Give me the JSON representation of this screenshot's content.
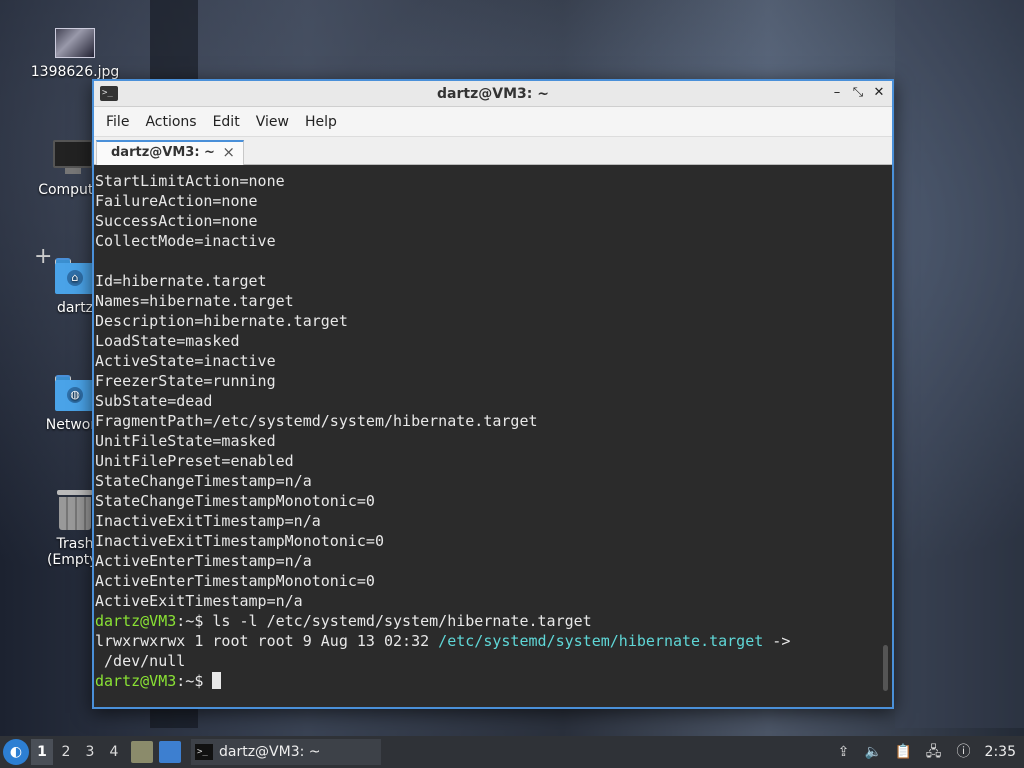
{
  "desktop": {
    "icons": [
      {
        "label": "1398626.jpg",
        "icon": "image-file-icon"
      },
      {
        "label": "Computer",
        "icon": "computer-icon"
      },
      {
        "label": "dartz",
        "icon": "home-folder-icon"
      },
      {
        "label": "Network",
        "icon": "network-folder-icon"
      },
      {
        "label": "Trash (Empty)",
        "icon": "trash-icon"
      }
    ]
  },
  "window": {
    "title": "dartz@VM3: ~",
    "menu": [
      "File",
      "Actions",
      "Edit",
      "View",
      "Help"
    ],
    "tab_label": "dartz@VM3: ~",
    "tab_close": "×",
    "controls": {
      "minimize": "–",
      "maximize": "⤡",
      "close": "✕"
    }
  },
  "terminal": {
    "lines": [
      "StartLimitAction=none",
      "FailureAction=none",
      "SuccessAction=none",
      "CollectMode=inactive",
      "",
      "Id=hibernate.target",
      "Names=hibernate.target",
      "Description=hibernate.target",
      "LoadState=masked",
      "ActiveState=inactive",
      "FreezerState=running",
      "SubState=dead",
      "FragmentPath=/etc/systemd/system/hibernate.target",
      "UnitFileState=masked",
      "UnitFilePreset=enabled",
      "StateChangeTimestamp=n/a",
      "StateChangeTimestampMonotonic=0",
      "InactiveExitTimestamp=n/a",
      "InactiveExitTimestampMonotonic=0",
      "ActiveEnterTimestamp=n/a",
      "ActiveEnterTimestampMonotonic=0",
      "ActiveExitTimestamp=n/a"
    ],
    "prompt_user": "dartz@VM3",
    "prompt_path": ":~$ ",
    "command": "ls -l /etc/systemd/system/hibernate.target",
    "ls_prefix": "lrwxrwxrwx 1 root root 9 Aug 13 02:32 ",
    "ls_link": "/etc/systemd/system/hibernate.target",
    "ls_arrow": " ->",
    "ls_target": " /dev/null"
  },
  "taskbar": {
    "start_icon": "lubuntu-start-icon",
    "workspaces": [
      "1",
      "2",
      "3",
      "4"
    ],
    "active_task": "dartz@VM3: ~",
    "clock": "2:35",
    "tray_icons": [
      "upload-icon",
      "volume-icon",
      "clipboard-icon",
      "network-icon",
      "update-notifier-icon"
    ]
  },
  "colors": {
    "prompt": "#8ae234",
    "symlink": "#5fd7d7",
    "accent": "#4a90d9"
  }
}
